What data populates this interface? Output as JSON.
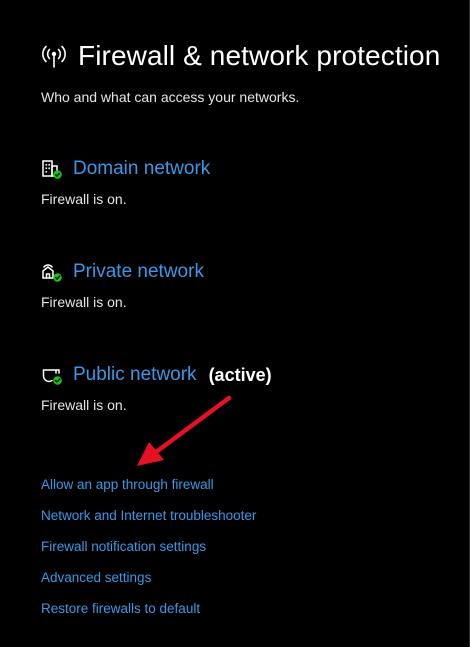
{
  "header": {
    "icon": "antenna-icon",
    "title": "Firewall & network protection",
    "subtitle": "Who and what can access your networks."
  },
  "networks": [
    {
      "name": "Domain network",
      "icon": "domain-network-icon",
      "status": "Firewall is on.",
      "active_label": ""
    },
    {
      "name": "Private network",
      "icon": "private-network-icon",
      "status": "Firewall is on.",
      "active_label": ""
    },
    {
      "name": "Public network",
      "icon": "public-network-icon",
      "status": "Firewall is on.",
      "active_label": "(active)"
    }
  ],
  "links": [
    "Allow an app through firewall",
    "Network and Internet troubleshooter",
    "Firewall notification settings",
    "Advanced settings",
    "Restore firewalls to default"
  ],
  "colors": {
    "background": "#000000",
    "link": "#3a98e6",
    "text": "#ffffff",
    "status_ok": "#16c60c",
    "annotation_arrow": "#e81123"
  }
}
